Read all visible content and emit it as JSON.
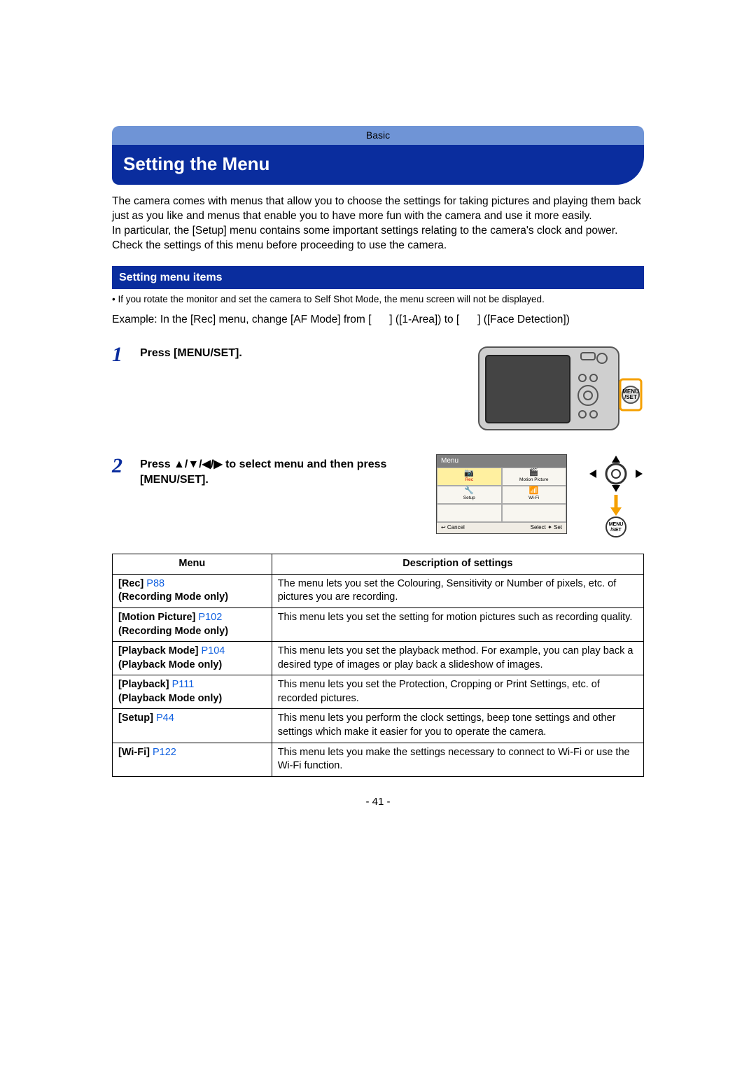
{
  "tab": "Basic",
  "title": "Setting the Menu",
  "intro": {
    "p1": "The camera comes with menus that allow you to choose the settings for taking pictures and playing them back just as you like and menus that enable you to have more fun with the camera and use it more easily.",
    "p2": "In particular, the [Setup] menu contains some important settings relating to the camera's clock and power.",
    "p3": "Check the settings of this menu before proceeding to use the camera."
  },
  "section1": {
    "header": "Setting menu items",
    "note": "• If you rotate the monitor and set the camera to Self Shot Mode, the menu screen will not be displayed.",
    "example": "Example: In the [Rec] menu, change [AF Mode] from [   ] ([1-Area]) to [   ] ([Face Detection])"
  },
  "steps": {
    "s1_num": "1",
    "s1_text": "Press [MENU/SET].",
    "s2_num": "2",
    "s2_text": "Press ▲/▼/◀/▶ to select menu and then press [MENU/SET].",
    "menuset_label_top": "MENU",
    "menuset_label_bot": "/SET"
  },
  "menu_screen": {
    "title": "Menu",
    "cells": {
      "rec": "Rec",
      "motion": "Motion Picture",
      "setup": "Setup",
      "wifi": "Wi-Fi"
    },
    "foot_left": "↩ Cancel",
    "foot_right": "Select ✦ Set"
  },
  "table": {
    "h1": "Menu",
    "h2": "Description of settings",
    "rows": [
      {
        "name": "[Rec]",
        "page": "P88",
        "sub": "(Recording Mode only)",
        "desc": "The menu lets you set the Colouring, Sensitivity or Number of pixels, etc. of pictures you are recording."
      },
      {
        "name": "[Motion Picture]",
        "page": "P102",
        "sub": "(Recording Mode only)",
        "desc": "This menu lets you set the setting for motion pictures such as recording quality."
      },
      {
        "name": "[Playback Mode]",
        "page": "P104",
        "sub": "(Playback Mode only)",
        "desc": "This menu lets you set the playback method. For example, you can play back a desired type of images or play back a slideshow of images."
      },
      {
        "name": "[Playback]",
        "page": "P111",
        "sub": "(Playback Mode only)",
        "desc": "This menu lets you set the Protection, Cropping or Print Settings, etc. of recorded pictures."
      },
      {
        "name": "[Setup]",
        "page": "P44",
        "sub": "",
        "desc": "This menu lets you perform the clock settings, beep tone settings and other settings which make it easier for you to operate the camera."
      },
      {
        "name": "[Wi-Fi]",
        "page": "P122",
        "sub": "",
        "desc": "This menu lets you make the settings necessary to connect to Wi-Fi or use the Wi-Fi function."
      }
    ]
  },
  "page_number": "- 41 -"
}
